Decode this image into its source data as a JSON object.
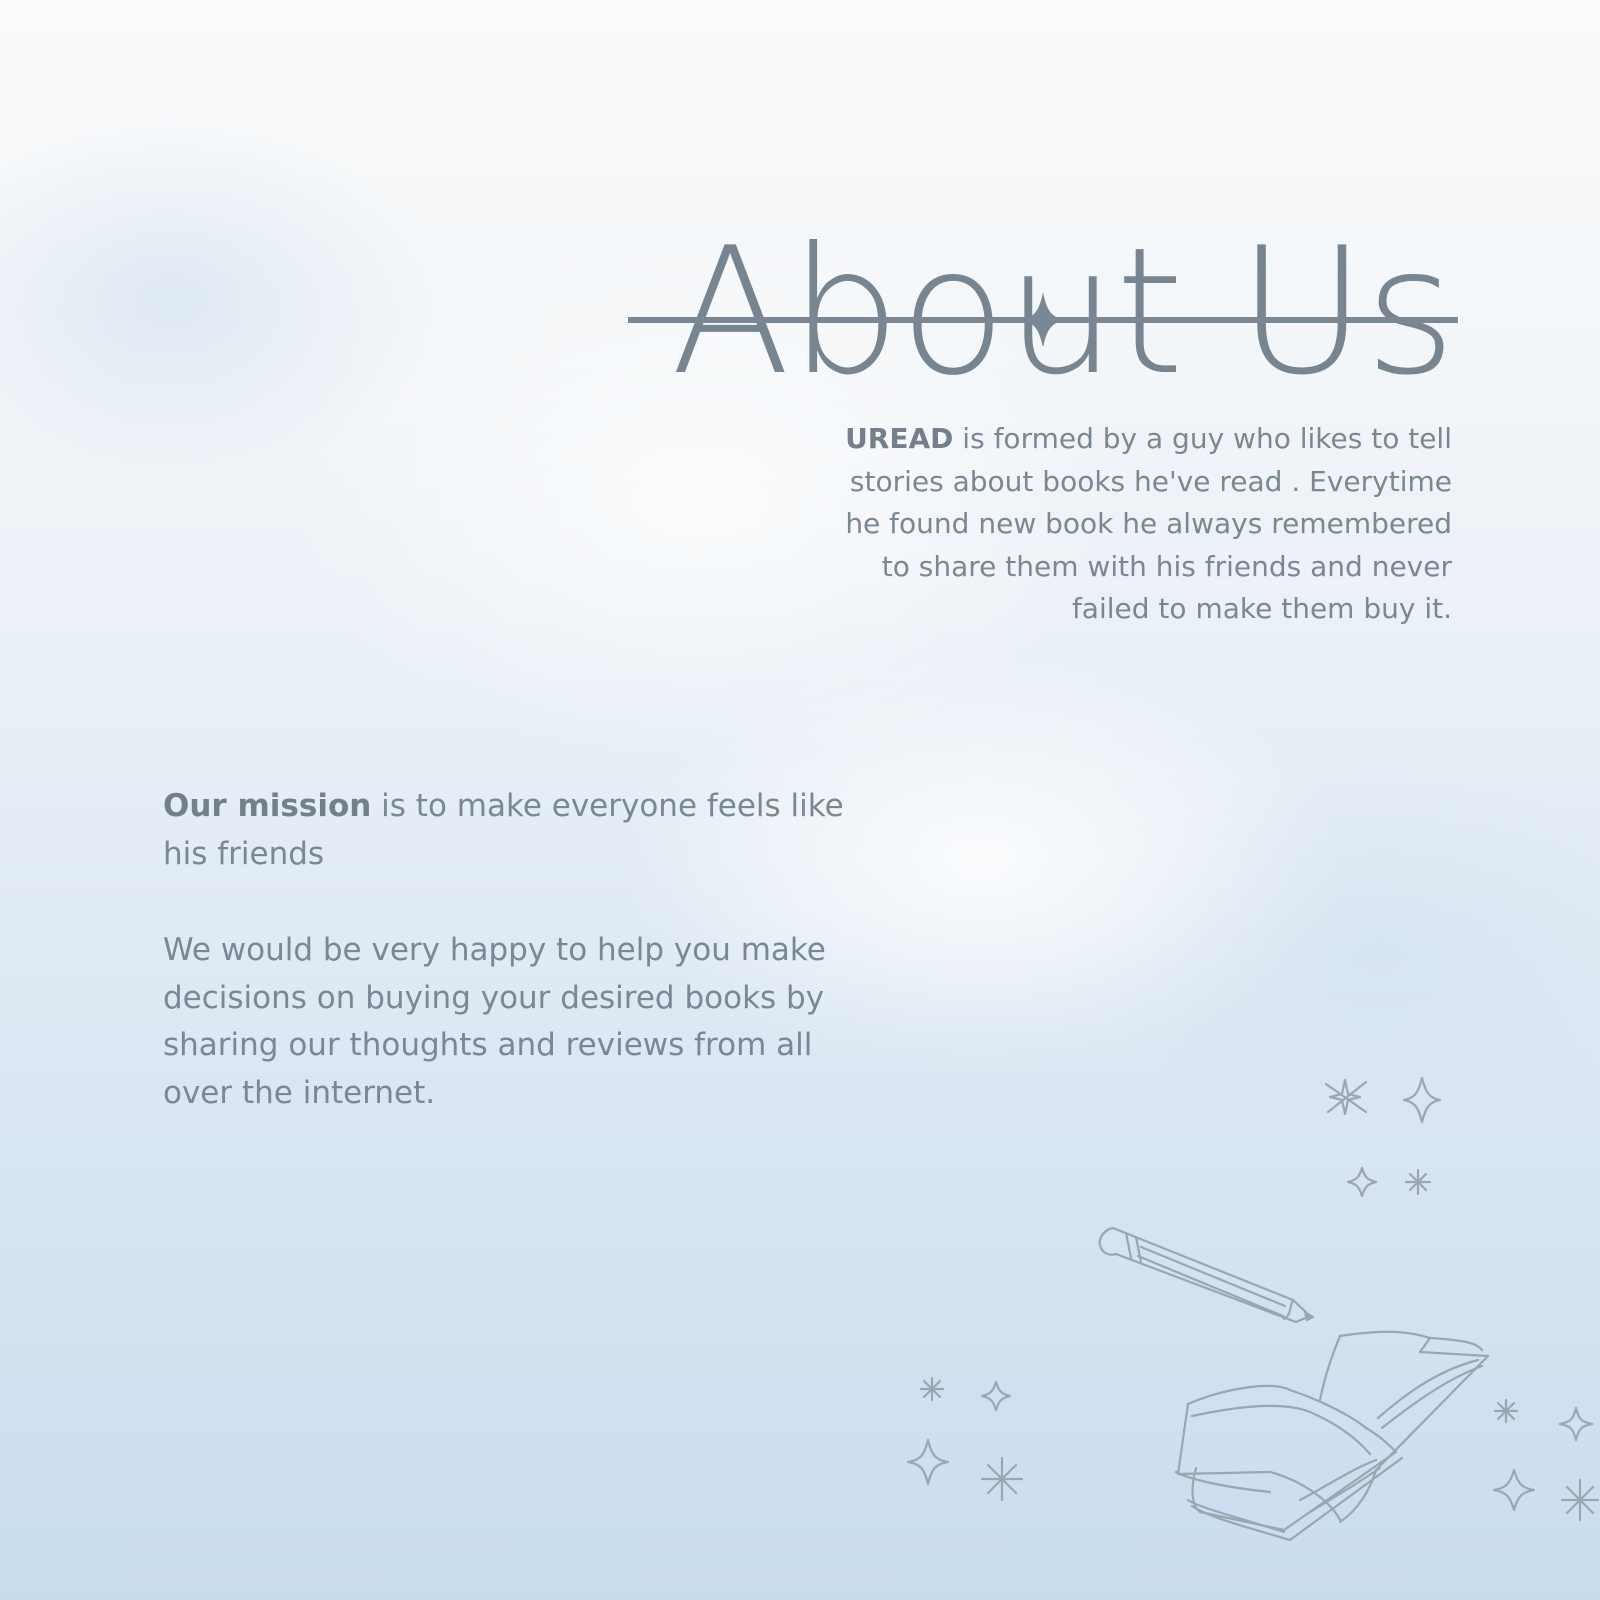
{
  "title": "About Us",
  "intro": {
    "brand": "UREAD",
    "text": " is formed by a guy who likes to tell stories about books he've read . Everytime he found new book he always remembered to share them with his friends and never failed to make them buy it."
  },
  "mission": {
    "lead": "Our mission",
    "text": " is to make everyone feels like his friends"
  },
  "help_text": "We would be very happy to help you make decisions on buying your desired books by sharing our thoughts and reviews from all over the internet.",
  "colors": {
    "text": "#7a8794",
    "title": "#778591",
    "divider": "#7a8794",
    "sketch": "#9aa6b2"
  },
  "icons": [
    "divider-ornament",
    "pencil-icon",
    "open-book-icon",
    "sparkle-icon"
  ]
}
